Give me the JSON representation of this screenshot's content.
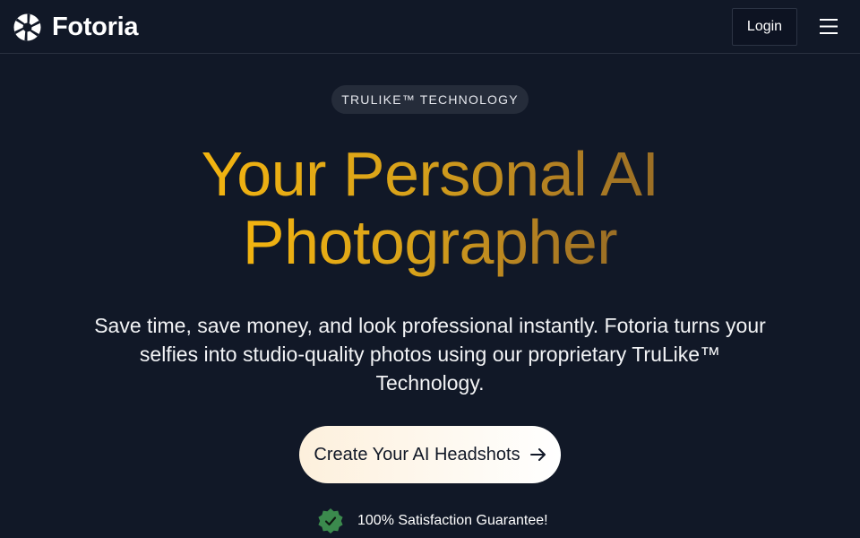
{
  "header": {
    "logo_text": "Fotoria",
    "logo_icon": "aperture-icon",
    "login_label": "Login",
    "menu_icon": "hamburger-menu-icon"
  },
  "hero": {
    "badge": "TRULIKE™ TECHNOLOGY",
    "headline_line1": "Your Personal AI",
    "headline_line2": "Photographer",
    "subtext_line1": "Save time, save money, and look professional instantly. Fotoria turns your",
    "subtext_line2": "selfies into studio-quality photos using our proprietary TruLike™",
    "subtext_line3": "Technology.",
    "cta_label": "Create Your AI Headshots",
    "cta_icon": "arrow-right-icon",
    "guarantee_text": "100% Satisfaction Guarantee!",
    "guarantee_icon": "check-badge-icon"
  },
  "colors": {
    "background": "#111827",
    "headline_gold_start": "#f3b410",
    "headline_gold_end": "#9a6e25",
    "badge_bg": "#252c3a",
    "guarantee_green": "#3b8a4d"
  }
}
